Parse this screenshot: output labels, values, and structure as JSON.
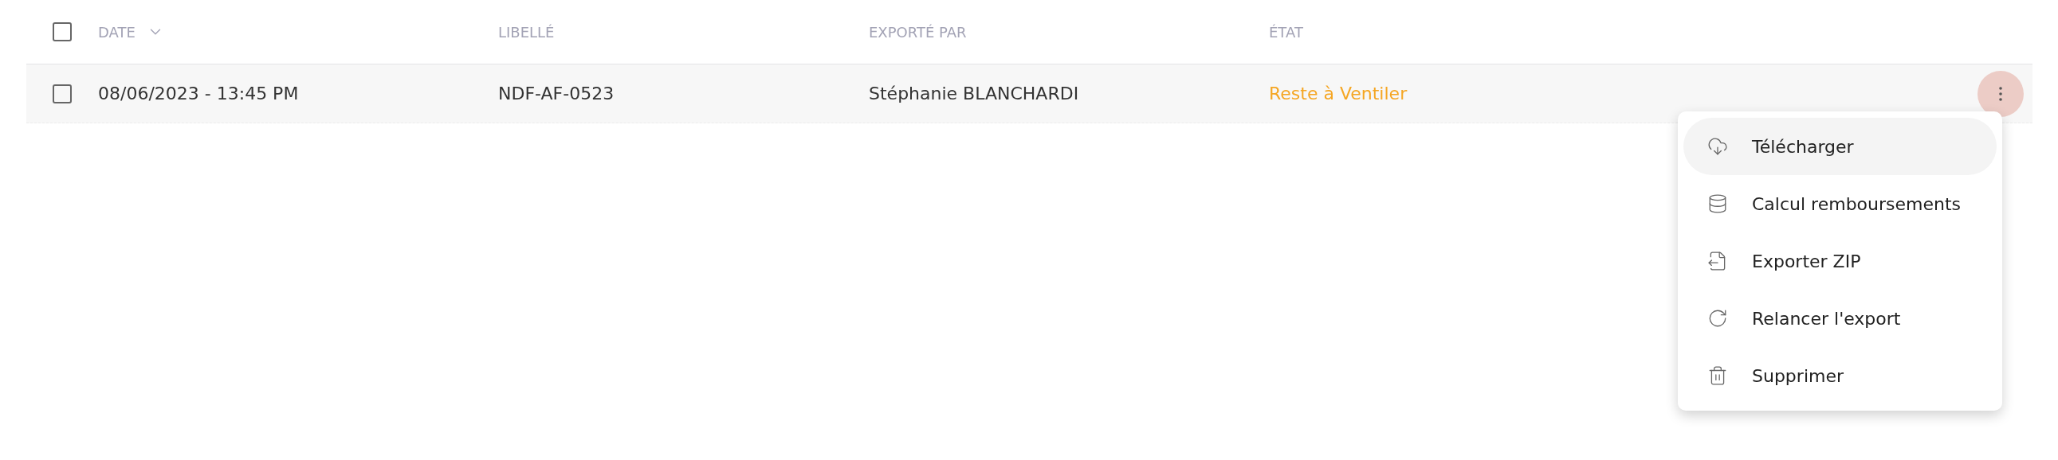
{
  "table": {
    "select_all": {
      "checked": false
    },
    "columns": [
      {
        "label": "DATE",
        "sorted": true
      },
      {
        "label": "LIBELLÉ",
        "sorted": false
      },
      {
        "label": "EXPORTÉ PAR",
        "sorted": false
      },
      {
        "label": "ÉTAT",
        "sorted": false
      }
    ],
    "rows": [
      {
        "checked": false,
        "date": "08/06/2023 - 13:45 PM",
        "label": "NDF-AF-0523",
        "exported_by": "Stéphanie BLANCHARDI",
        "state": "Reste à Ventiler"
      }
    ]
  },
  "actions_menu": {
    "open": true,
    "items": [
      {
        "kind": "download",
        "label": "Télécharger",
        "selected": true
      },
      {
        "kind": "coins",
        "label": "Calcul remboursements",
        "selected": false
      },
      {
        "kind": "export",
        "label": "Exporter ZIP",
        "selected": false
      },
      {
        "kind": "retry",
        "label": "Relancer l'export",
        "selected": false
      },
      {
        "kind": "delete",
        "label": "Supprimer",
        "selected": false
      }
    ]
  }
}
